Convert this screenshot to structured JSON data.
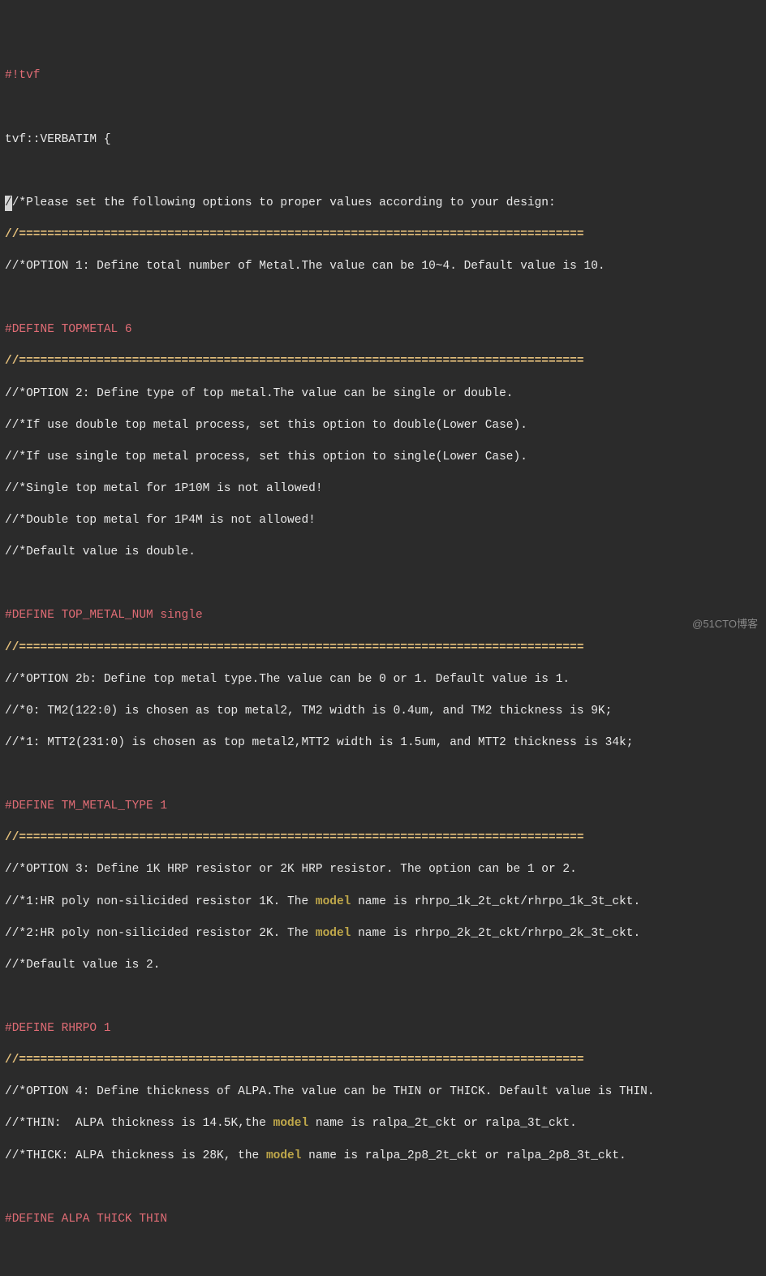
{
  "header": {
    "shebang": "#!tvf",
    "verbatim": "tvf::VERBATIM {"
  },
  "cursor_char": "/",
  "intro": {
    "l1_rest": "/*Please set the following options to proper values according to your design:",
    "sep": "//================================================================================",
    "opt1": "//*OPTION 1: Define total number of Metal.The value can be 10~4. Default value is 10."
  },
  "topmetal": {
    "define": "#DEFINE TOPMETAL 6",
    "sep": "//================================================================================",
    "opt2": "//*OPTION 2: Define type of top metal.The value can be single or double.",
    "l1": "//*If use double top metal process, set this option to double(Lower Case).",
    "l2": "//*If use single top metal process, set this option to single(Lower Case).",
    "l3": "//*Single top metal for 1P10M is not allowed!",
    "l4": "//*Double top metal for 1P4M is not allowed!",
    "l5": "//*Default value is double."
  },
  "top_metal_num": {
    "define": "#DEFINE TOP_METAL_NUM single",
    "sep": "//================================================================================",
    "opt2b": "//*OPTION 2b: Define top metal type.The value can be 0 or 1. Default value is 1.",
    "l1": "//*0: TM2(122:0) is chosen as top metal2, TM2 width is 0.4um, and TM2 thickness is 9K;",
    "l2": "//*1: MTT2(231:0) is chosen as top metal2,MTT2 width is 1.5um, and MTT2 thickness is 34k;"
  },
  "tm_metal_type": {
    "define": "#DEFINE TM_METAL_TYPE 1",
    "sep": "//================================================================================",
    "opt3": "//*OPTION 3: Define 1K HRP resistor or 2K HRP resistor. The option can be 1 or 2.",
    "l1a": "//*1:HR poly non-silicided resistor 1K. The ",
    "model": "model",
    "l1b": " name is rhrpo_1k_2t_ckt/rhrpo_1k_3t_ckt.",
    "l2a": "//*2:HR poly non-silicided resistor 2K. The ",
    "l2b": " name is rhrpo_2k_2t_ckt/rhrpo_2k_3t_ckt.",
    "l3": "//*Default value is 2."
  },
  "rhrpo": {
    "define": "#DEFINE RHRPO 1",
    "sep": "//================================================================================",
    "opt4": "//*OPTION 4: Define thickness of ALPA.The value can be THIN or THICK. Default value is THIN.",
    "l1a": "//*THIN:  ALPA thickness is 14.5K,the ",
    "model": "model",
    "l1b": " name is ralpa_2t_ckt or ralpa_3t_ckt.",
    "l2a": "//*THICK: ALPA thickness is 28K, the ",
    "l2b": " name is ralpa_2p8_2t_ckt or ralpa_2p8_3t_ckt."
  },
  "alpa": {
    "define": "#DEFINE ALPA THICK THIN"
  },
  "watermark": "@51CTO博客"
}
